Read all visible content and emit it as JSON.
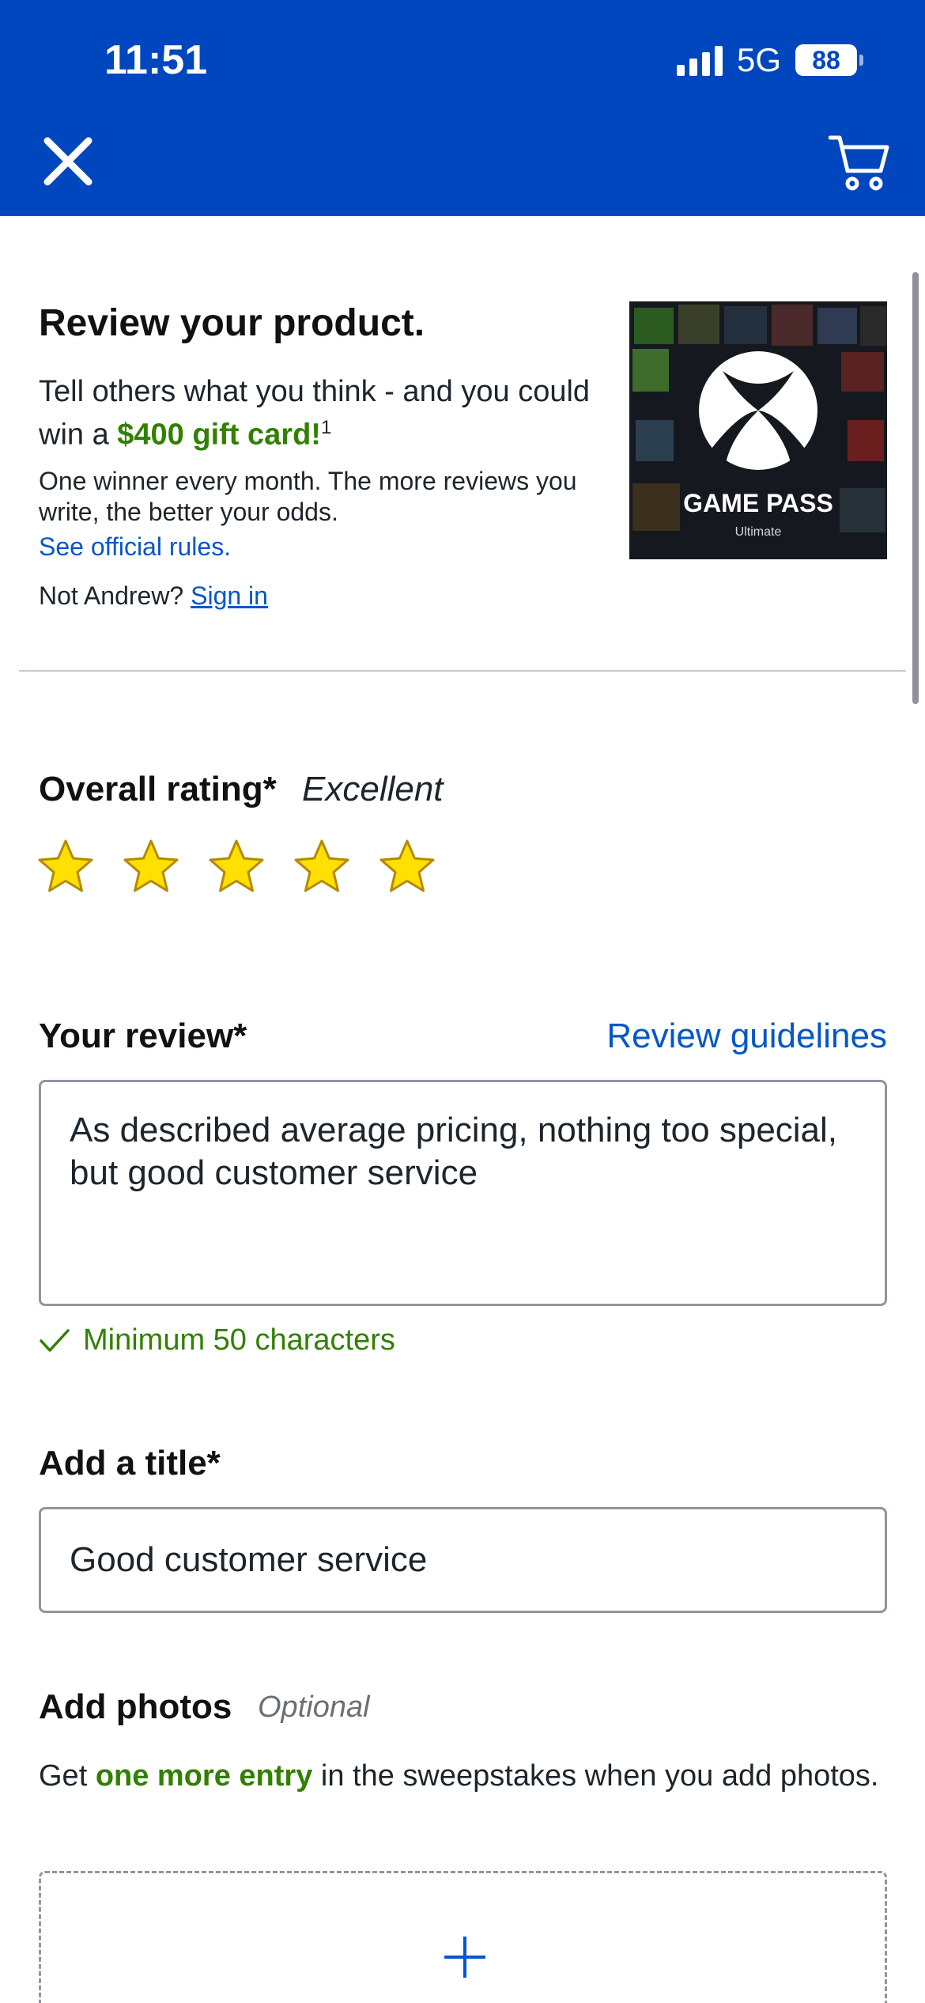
{
  "status": {
    "time": "11:51",
    "network": "5G",
    "battery": "88"
  },
  "nav": {
    "close": "close",
    "cart": "cart"
  },
  "intro": {
    "heading": "Review your product.",
    "promo_prefix": "Tell others what you think - and you could win a ",
    "promo_highlight": "$400 gift card!",
    "promo_sup": "1",
    "details": "One winner every month. The more reviews you write, the better your odds.",
    "rules_link": "See official rules.",
    "not_user": "Not Andrew?",
    "sign_in": "Sign in"
  },
  "product": {
    "image_text": "GAME PASS",
    "image_subtext": "Ultimate"
  },
  "rating": {
    "label": "Overall rating*",
    "value_text": "Excellent",
    "stars": 5,
    "max": 5
  },
  "review": {
    "label": "Your review*",
    "guidelines_link": "Review guidelines",
    "text": "As described average pricing, nothing too special, but good customer service",
    "validation": "Minimum 50 characters"
  },
  "title_field": {
    "label": "Add a title*",
    "value": "Good customer service"
  },
  "photos": {
    "label": "Add photos",
    "optional": "Optional",
    "text_prefix": "Get ",
    "text_highlight": "one more entry",
    "text_suffix": " in the sweepstakes when you add photos."
  },
  "colors": {
    "brand_blue": "#0046be",
    "link_blue": "#0457c8",
    "success_green": "#318000",
    "star_yellow": "#ffe000"
  }
}
